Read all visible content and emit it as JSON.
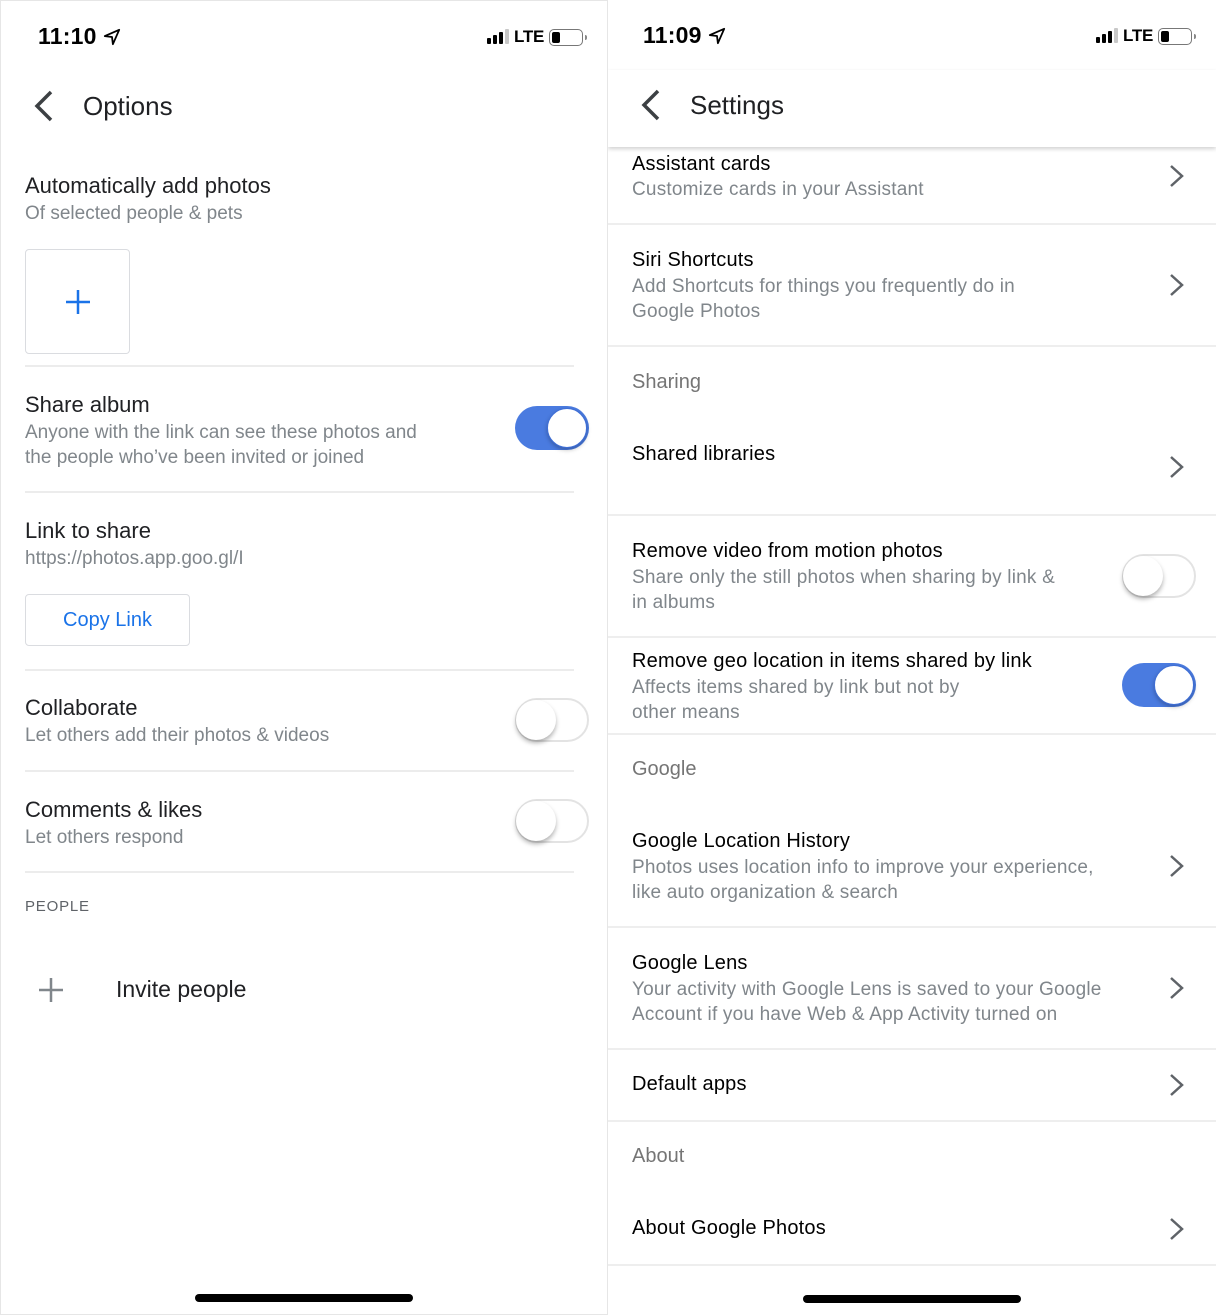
{
  "left": {
    "status": {
      "time": "11:10",
      "network": "LTE"
    },
    "app_bar": {
      "title": "Options"
    },
    "auto_add": {
      "title": "Automatically add photos",
      "subtitle": "Of selected people & pets"
    },
    "share_album": {
      "title": "Share album",
      "subtitle_line1": "Anyone with the link can see these photos and",
      "subtitle_line2": "the people who’ve been invited or joined",
      "enabled": true
    },
    "link_to_share": {
      "title": "Link to share",
      "url": "https://photos.app.goo.gl/I",
      "copy_label": "Copy Link"
    },
    "collaborate": {
      "title": "Collaborate",
      "subtitle": "Let others add their photos & videos",
      "enabled": false
    },
    "comments_likes": {
      "title": "Comments & likes",
      "subtitle": "Let others respond",
      "enabled": false
    },
    "people": {
      "header": "PEOPLE",
      "invite_label": "Invite people"
    }
  },
  "right": {
    "status": {
      "time": "11:09",
      "network": "LTE"
    },
    "app_bar": {
      "title": "Settings"
    },
    "assistant_cards": {
      "title": "Assistant cards",
      "subtitle": "Customize cards in your Assistant"
    },
    "siri_shortcuts": {
      "title": "Siri Shortcuts",
      "subtitle_line1": "Add Shortcuts for things you frequently do in",
      "subtitle_line2": "Google Photos"
    },
    "sharing_header": "Sharing",
    "shared_libraries": {
      "title": "Shared libraries"
    },
    "remove_video": {
      "title": "Remove video from motion photos",
      "subtitle_line1": "Share only the still photos when sharing by link &",
      "subtitle_line2": "in albums",
      "enabled": false
    },
    "remove_geo": {
      "title": "Remove geo location in items shared by link",
      "subtitle_line1": "Affects items shared by link but not by",
      "subtitle_line2": "other means",
      "enabled": true
    },
    "google_header": "Google",
    "location_history": {
      "title": "Google Location History",
      "subtitle_line1": "Photos uses location info to improve your experience,",
      "subtitle_line2": "like auto organization & search"
    },
    "google_lens": {
      "title": "Google Lens",
      "subtitle_line1": "Your activity with Google Lens is saved to your Google",
      "subtitle_line2": "Account if you have Web & App Activity turned on"
    },
    "default_apps": {
      "title": "Default apps"
    },
    "about_header": "About",
    "about_photos": {
      "title": "About Google Photos"
    }
  },
  "colors": {
    "accent": "#1a73e8",
    "toggle_on": "#4a7be0",
    "subtitle": "#80868b"
  }
}
